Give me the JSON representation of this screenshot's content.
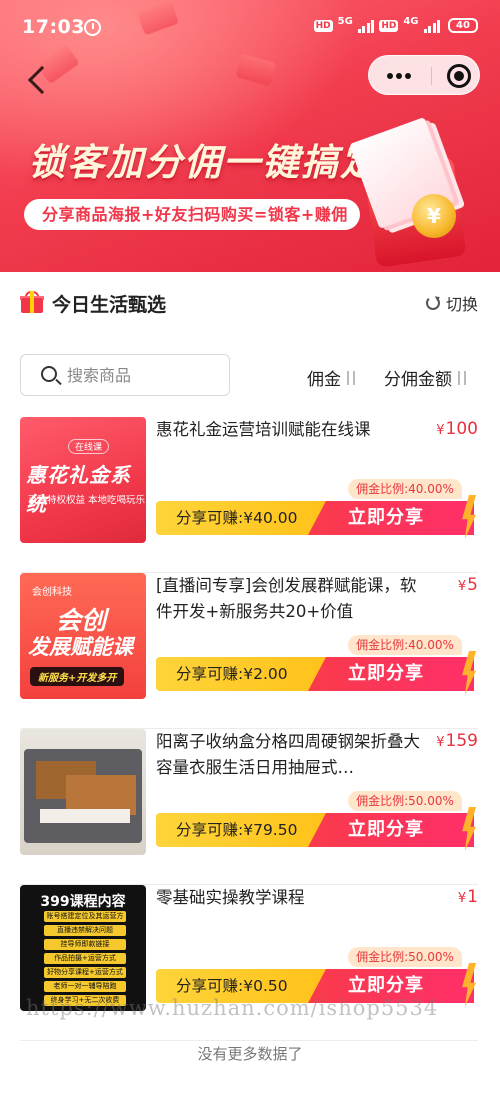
{
  "status": {
    "time": "17:03",
    "hd1": "HD",
    "net1": "5G",
    "hd2": "HD",
    "net2": "4G",
    "battery": "40"
  },
  "banner": {
    "title": "锁客加分佣一键搞定",
    "subtitle": "分享商品海报+好友扫码购买=锁客+赚佣",
    "coin_symbol": "¥"
  },
  "section": {
    "title": "今日生活甄选",
    "switch_label": "切换"
  },
  "search": {
    "placeholder": "搜索商品"
  },
  "sort": {
    "commission_label": "佣金",
    "amount_label": "分佣金额"
  },
  "products": [
    {
      "title": "惠花礼金运营培训赋能在线课",
      "price_symbol": "¥",
      "price": "100",
      "commission_ratio": "佣金比例:40.00%",
      "earn": "分享可赚:¥40.00",
      "share_label": "立即分享",
      "thumb": {
        "tag": "在线课",
        "main": "惠花礼金系统",
        "sub": "百种特权权益 本地吃喝玩乐"
      }
    },
    {
      "title": "[直播间专享]会创发展群赋能课，软件开发+新服务共20+价值",
      "price_symbol": "¥",
      "price": "5",
      "commission_ratio": "佣金比例:40.00%",
      "earn": "分享可赚:¥2.00",
      "share_label": "立即分享",
      "thumb": {
        "logo": "会创科技",
        "main1": "会创",
        "main2": "发展赋能课",
        "sub": "新服务+开发多开"
      }
    },
    {
      "title": "阳离子收纳盒分格四周硬钢架折叠大容量衣服生活日用抽屉式…",
      "price_symbol": "¥",
      "price": "159",
      "commission_ratio": "佣金比例:50.00%",
      "earn": "分享可赚:¥79.50",
      "share_label": "立即分享",
      "thumb": {}
    },
    {
      "title": "零基础实操教学课程",
      "price_symbol": "¥",
      "price": "1",
      "commission_ratio": "佣金比例:50.00%",
      "earn": "分享可赚:¥0.50",
      "share_label": "立即分享",
      "thumb": {
        "head": "399课程内容",
        "rows": [
          "账号搭建定位及其运营方法",
          "直播违禁解决问题",
          "挂导师即款链接",
          "作品拍摄+运营方式",
          "好物分享课程+运营方式",
          "老师一对一辅导陪跑",
          "终身学习+无二次收费"
        ]
      }
    }
  ],
  "footer": {
    "no_more": "没有更多数据了",
    "watermark": "https://www.huzhan.com/ishop5534"
  },
  "colors": {
    "brand_red": "#f2364a",
    "earn_yellow": "#ffc21a",
    "price_red": "#e8303e"
  }
}
